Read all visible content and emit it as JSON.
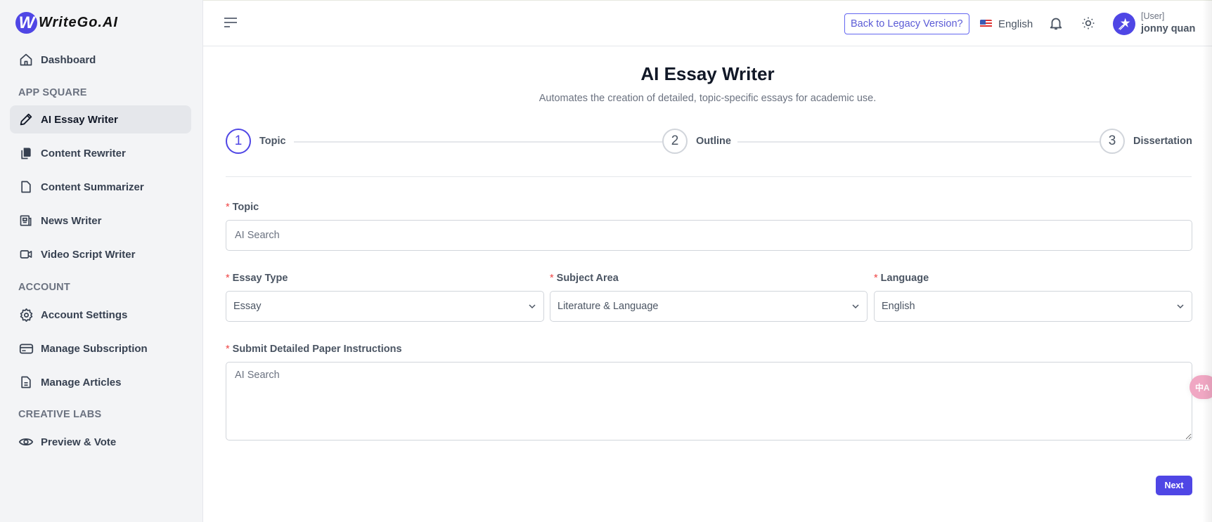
{
  "brand": {
    "name": "WriteGo.AI",
    "logo_letter": "W"
  },
  "sidebar": {
    "dashboard": {
      "label": "Dashboard",
      "icon": "home-icon"
    },
    "sections": [
      {
        "title": "APP SQUARE",
        "items": [
          {
            "label": "AI Essay Writer",
            "icon": "pencil-icon",
            "active": true
          },
          {
            "label": "Content Rewriter",
            "icon": "copy-icon",
            "active": false
          },
          {
            "label": "Content Summarizer",
            "icon": "file-icon",
            "active": false
          },
          {
            "label": "News Writer",
            "icon": "newspaper-icon",
            "active": false
          },
          {
            "label": "Video Script Writer",
            "icon": "video-icon",
            "active": false
          }
        ]
      },
      {
        "title": "ACCOUNT",
        "items": [
          {
            "label": "Account Settings",
            "icon": "gear-icon",
            "active": false
          },
          {
            "label": "Manage Subscription",
            "icon": "credit-card-icon",
            "active": false
          },
          {
            "label": "Manage Articles",
            "icon": "document-icon",
            "active": false
          }
        ]
      },
      {
        "title": "CREATIVE LABS",
        "items": [
          {
            "label": "Preview & Vote",
            "icon": "eye-icon",
            "active": false
          }
        ]
      }
    ]
  },
  "topbar": {
    "legacy_button": "Back to Legacy Version?",
    "language": "English",
    "language_flag": "us-flag-icon",
    "user_role": "[User]",
    "user_name": "jonny quan"
  },
  "page": {
    "title": "AI Essay Writer",
    "subtitle": "Automates the creation of detailed, topic-specific essays for academic use."
  },
  "steps": [
    {
      "number": "1",
      "label": "Topic",
      "active": true
    },
    {
      "number": "2",
      "label": "Outline",
      "active": false
    },
    {
      "number": "3",
      "label": "Dissertation",
      "active": false
    }
  ],
  "form": {
    "required_mark": "*",
    "topic": {
      "label": "Topic",
      "value": "",
      "placeholder": "AI Search"
    },
    "essay_type": {
      "label": "Essay Type",
      "value": "Essay"
    },
    "subject_area": {
      "label": "Subject Area",
      "value": "Literature & Language"
    },
    "language": {
      "label": "Language",
      "value": "English"
    },
    "instructions": {
      "label": "Submit Detailed Paper Instructions",
      "value": "",
      "placeholder": "AI Search"
    },
    "next_button": "Next"
  },
  "floating": {
    "translate_label": "中A"
  },
  "colors": {
    "accent": "#4f46e5",
    "required": "#ef4444",
    "sidebar_bg": "#f3f4f6",
    "translate_fab": "#f0a7c3"
  }
}
